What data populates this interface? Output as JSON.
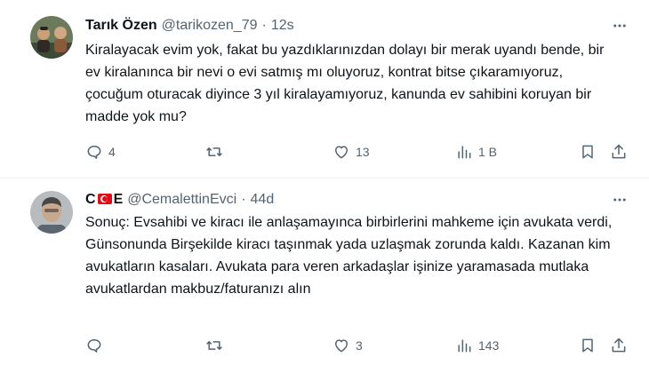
{
  "tweets": [
    {
      "name": "Tarık Özen",
      "handle": "@tarikozen_79",
      "separator": "·",
      "time": "12s",
      "text": "Kiralayacak evim yok, fakat bu yazdıklarınızdan dolayı bir merak uyandı bende, bir ev kiralanınca bir nevi o evi satmış mı oluyoruz, kontrat bitse çıkaramıyoruz, çocuğum oturacak diyince 3 yıl kiralayamıyoruz, kanunda ev sahibini koruyan bir madde yok mu?",
      "replies": "4",
      "retweets": "",
      "likes": "13",
      "views": "1 B"
    },
    {
      "name_part1": "C",
      "name_part2": "E",
      "name_emoji": "turkish-flag",
      "handle": "@CemalettinEvci",
      "separator": "·",
      "time": "44d",
      "text": "Sonuç: Evsahibi ve kiracı ile anlaşamayınca birbirlerini mahkeme için avukata verdi, Günsonunda Birşekilde kiracı taşınmak yada uzlaşmak zorunda kaldı. Kazanan kim avukatların kasaları. Avukata para veren arkadaşlar işinize yaramasada mutlaka avukatlardan makbuz/faturanızı alın",
      "replies": "",
      "retweets": "",
      "likes": "3",
      "views": "143"
    }
  ],
  "icons": {
    "reply": "reply-icon",
    "retweet": "retweet-icon",
    "like": "heart-icon",
    "views": "views-icon",
    "bookmark": "bookmark-icon",
    "share": "share-icon",
    "more": "more-icon"
  },
  "colors": {
    "text": "#0f1419",
    "secondary": "#536471",
    "divider": "#eff3f4",
    "flag_red": "#e30a17"
  }
}
